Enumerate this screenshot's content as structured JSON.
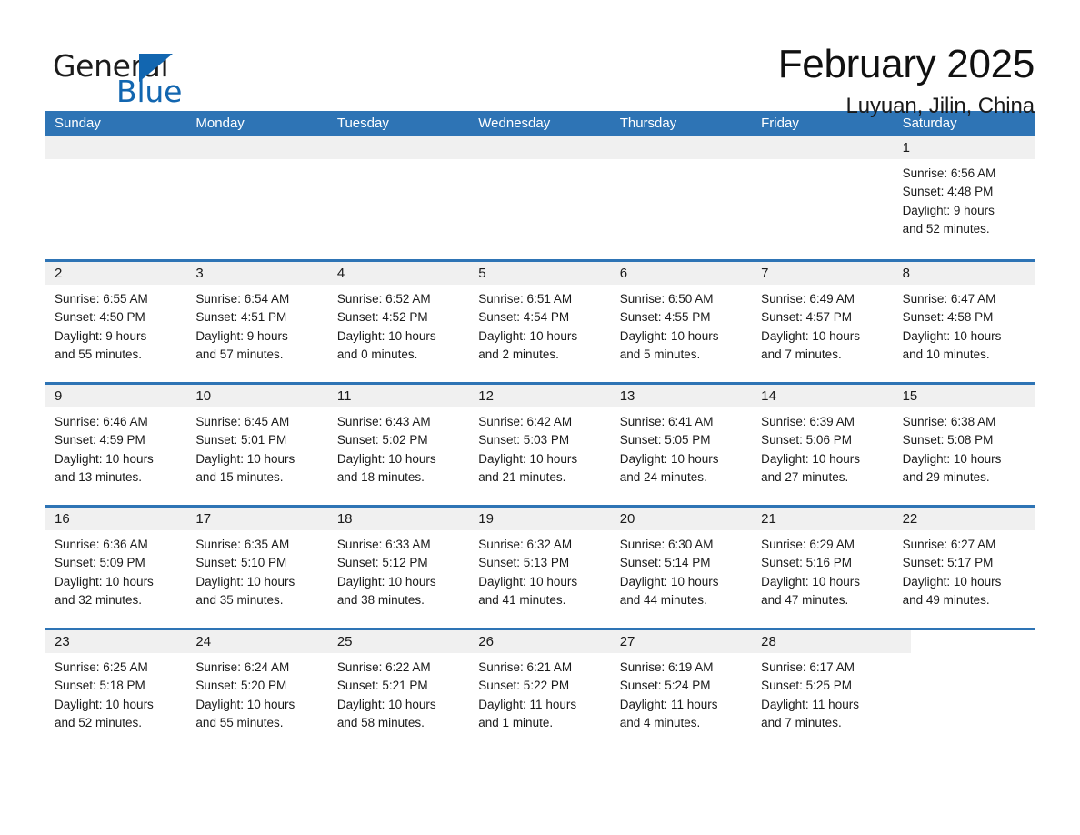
{
  "brand": {
    "word_one": "General",
    "word_two": "Blue",
    "logo_icon": "triangle-logo-icon",
    "accent_color": "#1266b0"
  },
  "header": {
    "title": "February 2025",
    "subtitle": "Luyuan, Jilin, China"
  },
  "calendar": {
    "header_color": "#2e74b5",
    "datebar_color": "#f0f0f0",
    "weekdays": [
      "Sunday",
      "Monday",
      "Tuesday",
      "Wednesday",
      "Thursday",
      "Friday",
      "Saturday"
    ],
    "weeks": [
      [
        {
          "day": "",
          "sunrise": "",
          "sunset": "",
          "daylight_line1": "",
          "daylight_line2": ""
        },
        {
          "day": "",
          "sunrise": "",
          "sunset": "",
          "daylight_line1": "",
          "daylight_line2": ""
        },
        {
          "day": "",
          "sunrise": "",
          "sunset": "",
          "daylight_line1": "",
          "daylight_line2": ""
        },
        {
          "day": "",
          "sunrise": "",
          "sunset": "",
          "daylight_line1": "",
          "daylight_line2": ""
        },
        {
          "day": "",
          "sunrise": "",
          "sunset": "",
          "daylight_line1": "",
          "daylight_line2": ""
        },
        {
          "day": "",
          "sunrise": "",
          "sunset": "",
          "daylight_line1": "",
          "daylight_line2": ""
        },
        {
          "day": "1",
          "sunrise": "Sunrise: 6:56 AM",
          "sunset": "Sunset: 4:48 PM",
          "daylight_line1": "Daylight: 9 hours",
          "daylight_line2": "and 52 minutes."
        }
      ],
      [
        {
          "day": "2",
          "sunrise": "Sunrise: 6:55 AM",
          "sunset": "Sunset: 4:50 PM",
          "daylight_line1": "Daylight: 9 hours",
          "daylight_line2": "and 55 minutes."
        },
        {
          "day": "3",
          "sunrise": "Sunrise: 6:54 AM",
          "sunset": "Sunset: 4:51 PM",
          "daylight_line1": "Daylight: 9 hours",
          "daylight_line2": "and 57 minutes."
        },
        {
          "day": "4",
          "sunrise": "Sunrise: 6:52 AM",
          "sunset": "Sunset: 4:52 PM",
          "daylight_line1": "Daylight: 10 hours",
          "daylight_line2": "and 0 minutes."
        },
        {
          "day": "5",
          "sunrise": "Sunrise: 6:51 AM",
          "sunset": "Sunset: 4:54 PM",
          "daylight_line1": "Daylight: 10 hours",
          "daylight_line2": "and 2 minutes."
        },
        {
          "day": "6",
          "sunrise": "Sunrise: 6:50 AM",
          "sunset": "Sunset: 4:55 PM",
          "daylight_line1": "Daylight: 10 hours",
          "daylight_line2": "and 5 minutes."
        },
        {
          "day": "7",
          "sunrise": "Sunrise: 6:49 AM",
          "sunset": "Sunset: 4:57 PM",
          "daylight_line1": "Daylight: 10 hours",
          "daylight_line2": "and 7 minutes."
        },
        {
          "day": "8",
          "sunrise": "Sunrise: 6:47 AM",
          "sunset": "Sunset: 4:58 PM",
          "daylight_line1": "Daylight: 10 hours",
          "daylight_line2": "and 10 minutes."
        }
      ],
      [
        {
          "day": "9",
          "sunrise": "Sunrise: 6:46 AM",
          "sunset": "Sunset: 4:59 PM",
          "daylight_line1": "Daylight: 10 hours",
          "daylight_line2": "and 13 minutes."
        },
        {
          "day": "10",
          "sunrise": "Sunrise: 6:45 AM",
          "sunset": "Sunset: 5:01 PM",
          "daylight_line1": "Daylight: 10 hours",
          "daylight_line2": "and 15 minutes."
        },
        {
          "day": "11",
          "sunrise": "Sunrise: 6:43 AM",
          "sunset": "Sunset: 5:02 PM",
          "daylight_line1": "Daylight: 10 hours",
          "daylight_line2": "and 18 minutes."
        },
        {
          "day": "12",
          "sunrise": "Sunrise: 6:42 AM",
          "sunset": "Sunset: 5:03 PM",
          "daylight_line1": "Daylight: 10 hours",
          "daylight_line2": "and 21 minutes."
        },
        {
          "day": "13",
          "sunrise": "Sunrise: 6:41 AM",
          "sunset": "Sunset: 5:05 PM",
          "daylight_line1": "Daylight: 10 hours",
          "daylight_line2": "and 24 minutes."
        },
        {
          "day": "14",
          "sunrise": "Sunrise: 6:39 AM",
          "sunset": "Sunset: 5:06 PM",
          "daylight_line1": "Daylight: 10 hours",
          "daylight_line2": "and 27 minutes."
        },
        {
          "day": "15",
          "sunrise": "Sunrise: 6:38 AM",
          "sunset": "Sunset: 5:08 PM",
          "daylight_line1": "Daylight: 10 hours",
          "daylight_line2": "and 29 minutes."
        }
      ],
      [
        {
          "day": "16",
          "sunrise": "Sunrise: 6:36 AM",
          "sunset": "Sunset: 5:09 PM",
          "daylight_line1": "Daylight: 10 hours",
          "daylight_line2": "and 32 minutes."
        },
        {
          "day": "17",
          "sunrise": "Sunrise: 6:35 AM",
          "sunset": "Sunset: 5:10 PM",
          "daylight_line1": "Daylight: 10 hours",
          "daylight_line2": "and 35 minutes."
        },
        {
          "day": "18",
          "sunrise": "Sunrise: 6:33 AM",
          "sunset": "Sunset: 5:12 PM",
          "daylight_line1": "Daylight: 10 hours",
          "daylight_line2": "and 38 minutes."
        },
        {
          "day": "19",
          "sunrise": "Sunrise: 6:32 AM",
          "sunset": "Sunset: 5:13 PM",
          "daylight_line1": "Daylight: 10 hours",
          "daylight_line2": "and 41 minutes."
        },
        {
          "day": "20",
          "sunrise": "Sunrise: 6:30 AM",
          "sunset": "Sunset: 5:14 PM",
          "daylight_line1": "Daylight: 10 hours",
          "daylight_line2": "and 44 minutes."
        },
        {
          "day": "21",
          "sunrise": "Sunrise: 6:29 AM",
          "sunset": "Sunset: 5:16 PM",
          "daylight_line1": "Daylight: 10 hours",
          "daylight_line2": "and 47 minutes."
        },
        {
          "day": "22",
          "sunrise": "Sunrise: 6:27 AM",
          "sunset": "Sunset: 5:17 PM",
          "daylight_line1": "Daylight: 10 hours",
          "daylight_line2": "and 49 minutes."
        }
      ],
      [
        {
          "day": "23",
          "sunrise": "Sunrise: 6:25 AM",
          "sunset": "Sunset: 5:18 PM",
          "daylight_line1": "Daylight: 10 hours",
          "daylight_line2": "and 52 minutes."
        },
        {
          "day": "24",
          "sunrise": "Sunrise: 6:24 AM",
          "sunset": "Sunset: 5:20 PM",
          "daylight_line1": "Daylight: 10 hours",
          "daylight_line2": "and 55 minutes."
        },
        {
          "day": "25",
          "sunrise": "Sunrise: 6:22 AM",
          "sunset": "Sunset: 5:21 PM",
          "daylight_line1": "Daylight: 10 hours",
          "daylight_line2": "and 58 minutes."
        },
        {
          "day": "26",
          "sunrise": "Sunrise: 6:21 AM",
          "sunset": "Sunset: 5:22 PM",
          "daylight_line1": "Daylight: 11 hours",
          "daylight_line2": "and 1 minute."
        },
        {
          "day": "27",
          "sunrise": "Sunrise: 6:19 AM",
          "sunset": "Sunset: 5:24 PM",
          "daylight_line1": "Daylight: 11 hours",
          "daylight_line2": "and 4 minutes."
        },
        {
          "day": "28",
          "sunrise": "Sunrise: 6:17 AM",
          "sunset": "Sunset: 5:25 PM",
          "daylight_line1": "Daylight: 11 hours",
          "daylight_line2": "and 7 minutes."
        },
        {
          "day": "",
          "sunrise": "",
          "sunset": "",
          "daylight_line1": "",
          "daylight_line2": ""
        }
      ]
    ]
  }
}
